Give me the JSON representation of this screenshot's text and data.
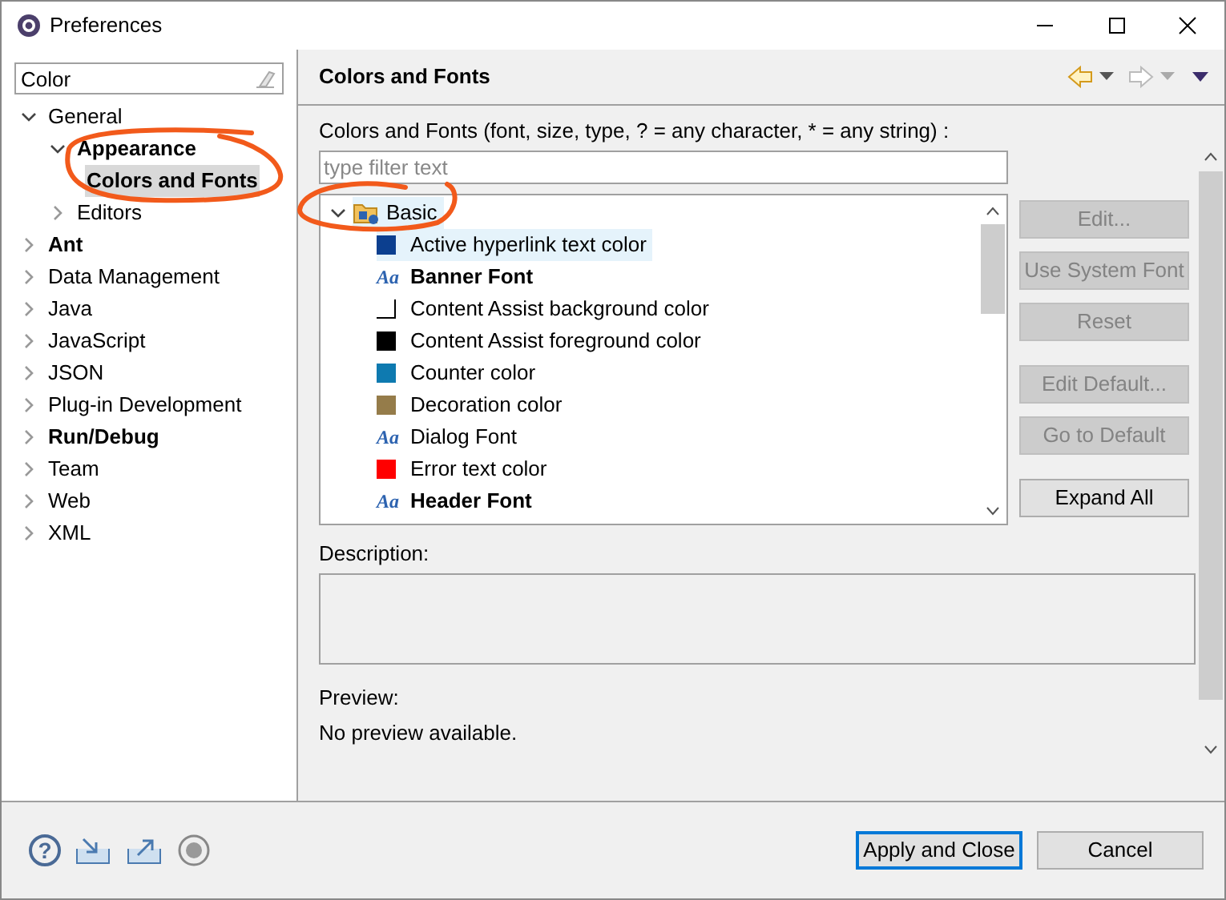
{
  "window": {
    "title": "Preferences"
  },
  "sidebar": {
    "search": {
      "value": "Color"
    },
    "items": [
      {
        "label": "General",
        "bold": false,
        "selected": false,
        "expanded": true,
        "children": [
          {
            "label": "Appearance",
            "bold": true,
            "selected": false,
            "expanded": true,
            "children": [
              {
                "label": "Colors and Fonts",
                "bold": true,
                "selected": true
              }
            ]
          },
          {
            "label": "Editors",
            "bold": false,
            "selected": false,
            "expanded": false
          }
        ]
      },
      {
        "label": "Ant",
        "bold": true,
        "selected": false,
        "expanded": false
      },
      {
        "label": "Data Management",
        "bold": false,
        "selected": false,
        "expanded": false
      },
      {
        "label": "Java",
        "bold": false,
        "selected": false,
        "expanded": false
      },
      {
        "label": "JavaScript",
        "bold": false,
        "selected": false,
        "expanded": false
      },
      {
        "label": "JSON",
        "bold": false,
        "selected": false,
        "expanded": false
      },
      {
        "label": "Plug-in Development",
        "bold": false,
        "selected": false,
        "expanded": false
      },
      {
        "label": "Run/Debug",
        "bold": true,
        "selected": false,
        "expanded": false
      },
      {
        "label": "Team",
        "bold": false,
        "selected": false,
        "expanded": false
      },
      {
        "label": "Web",
        "bold": false,
        "selected": false,
        "expanded": false
      },
      {
        "label": "XML",
        "bold": false,
        "selected": false,
        "expanded": false
      }
    ]
  },
  "page": {
    "title": "Colors and Fonts",
    "filter_label": "Colors and Fonts (font, size, type, ? = any character, * = any string) :",
    "filter": {
      "placeholder": "type filter text"
    },
    "tree": {
      "category": {
        "label": "Basic",
        "expanded": true
      },
      "items": [
        {
          "kind": "color",
          "label": "Active hyperlink text color",
          "color": "#0c3f8f",
          "bold": false,
          "selected": true
        },
        {
          "kind": "font",
          "glyph": "Aa",
          "label": "Banner Font",
          "bold": true,
          "selected": false
        },
        {
          "kind": "color",
          "label": "Content Assist background color",
          "color": "#ffffff",
          "bold": false,
          "selected": false
        },
        {
          "kind": "color",
          "label": "Content Assist foreground color",
          "color": "#000000",
          "bold": false,
          "selected": false
        },
        {
          "kind": "color",
          "label": "Counter color",
          "color": "#0e7ab0",
          "bold": false,
          "selected": false
        },
        {
          "kind": "color",
          "label": "Decoration color",
          "color": "#957c4a",
          "bold": false,
          "selected": false
        },
        {
          "kind": "font",
          "glyph": "Aa",
          "label": "Dialog Font",
          "bold": false,
          "selected": false
        },
        {
          "kind": "color",
          "label": "Error text color",
          "color": "#ff0000",
          "bold": false,
          "selected": false
        },
        {
          "kind": "font",
          "glyph": "Aa",
          "label": "Header Font",
          "bold": true,
          "selected": false
        }
      ]
    },
    "buttons": [
      {
        "label": "Edit...",
        "disabled": true
      },
      {
        "label": "Use System Font",
        "disabled": true
      },
      {
        "label": "Reset",
        "disabled": true
      },
      {
        "label": "Edit Default...",
        "disabled": true
      },
      {
        "label": "Go to Default",
        "disabled": true
      },
      {
        "label": "Expand All",
        "disabled": false
      }
    ],
    "description_label": "Description:",
    "preview_label": "Preview:",
    "preview_text": "No preview available."
  },
  "footer": {
    "help_glyph": "?",
    "buttons": [
      {
        "label": "Apply and Close",
        "default": true
      },
      {
        "label": "Cancel",
        "default": false
      }
    ]
  },
  "annotation_marks": [
    {
      "kind": "ellipse"
    },
    {
      "kind": "ellipse"
    }
  ]
}
